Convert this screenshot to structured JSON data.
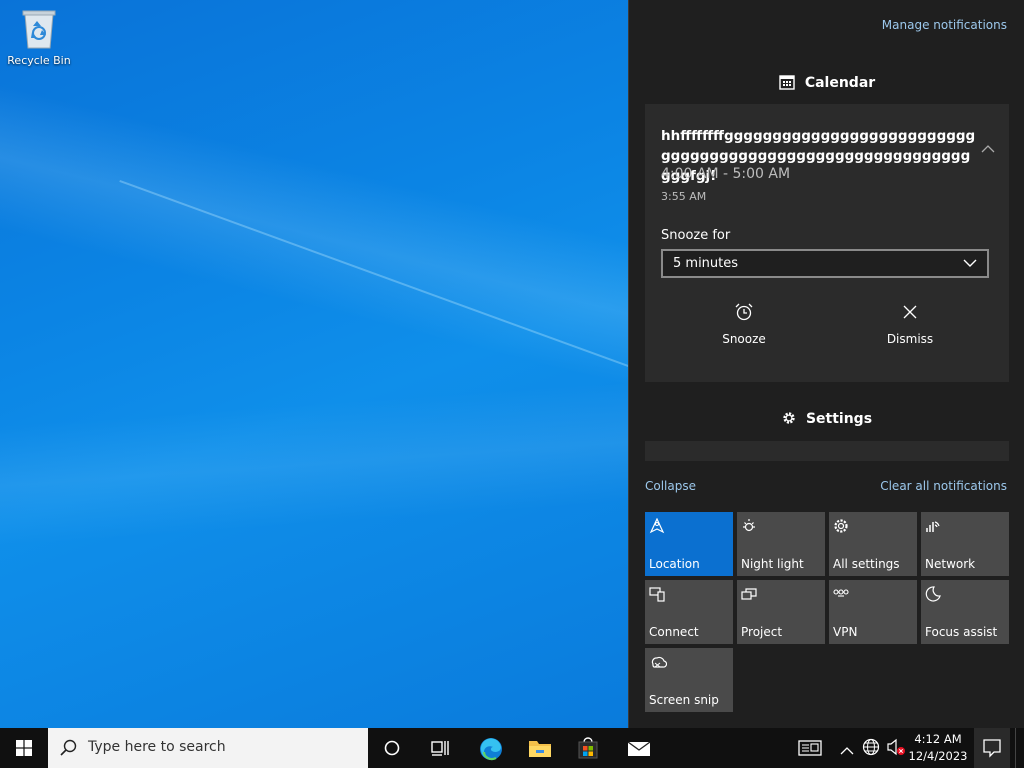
{
  "desktop": {
    "recycle_bin_label": "Recycle Bin"
  },
  "action_center": {
    "manage_label": "Manage notifications",
    "calendar_header": "Calendar",
    "notification": {
      "title": "hhffffffffgggggggggggggggggggggggggggggggggggggggggggggggggggggggggggggfgj!",
      "time_range": "4:00 AM - 5:00 AM",
      "timestamp": "3:55 AM",
      "snooze_label": "Snooze for",
      "snooze_value": "5 minutes",
      "snooze_button": "Snooze",
      "dismiss_button": "Dismiss"
    },
    "settings_header": "Settings",
    "collapse_label": "Collapse",
    "clear_all_label": "Clear all notifications",
    "tiles": [
      {
        "label": "Location",
        "icon": "location-icon",
        "active": true
      },
      {
        "label": "Night light",
        "icon": "night-light-icon",
        "active": false
      },
      {
        "label": "All settings",
        "icon": "gear-icon",
        "active": false
      },
      {
        "label": "Network",
        "icon": "network-icon",
        "active": false
      },
      {
        "label": "Connect",
        "icon": "connect-icon",
        "active": false
      },
      {
        "label": "Project",
        "icon": "project-icon",
        "active": false
      },
      {
        "label": "VPN",
        "icon": "vpn-icon",
        "active": false
      },
      {
        "label": "Focus assist",
        "icon": "moon-icon",
        "active": false
      },
      {
        "label": "Screen snip",
        "icon": "screen-snip-icon",
        "active": false
      }
    ]
  },
  "taskbar": {
    "search_placeholder": "Type here to search",
    "time": "4:12 AM",
    "date": "12/4/2023"
  },
  "colors": {
    "accent": "#0b70d0",
    "link": "#9cc8ec",
    "panel": "#1f1f1f",
    "card": "#2b2b2b",
    "tile": "#4a4a4a"
  }
}
